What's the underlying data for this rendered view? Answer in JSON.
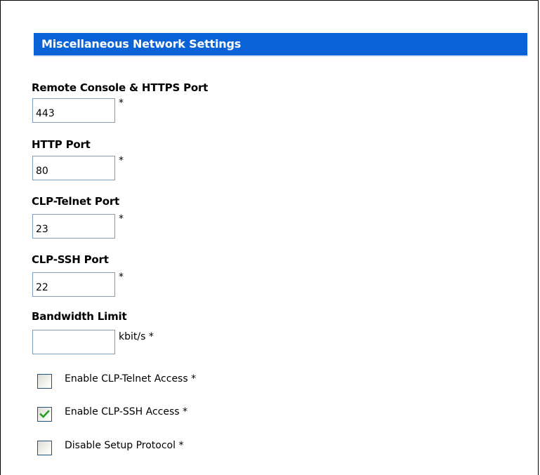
{
  "section": {
    "title": "Miscellaneous Network Settings"
  },
  "fields": [
    {
      "label": "Remote Console & HTTPS Port",
      "value": "443",
      "required": "*"
    },
    {
      "label": "HTTP Port",
      "value": "80",
      "required": "*"
    },
    {
      "label": "CLP-Telnet Port",
      "value": "23",
      "required": "*"
    },
    {
      "label": "CLP-SSH Port",
      "value": "22",
      "required": "*"
    }
  ],
  "bandwidth": {
    "label": "Bandwidth Limit",
    "value": "",
    "unit": "kbit/s *"
  },
  "checkboxes": [
    {
      "label": "Enable CLP-Telnet Access *",
      "checked": false
    },
    {
      "label": "Enable CLP-SSH Access *",
      "checked": true
    },
    {
      "label": "Disable Setup Protocol *",
      "checked": false
    }
  ],
  "colors": {
    "header_bg": "#0a63d6",
    "checkmark": "#21a121"
  }
}
